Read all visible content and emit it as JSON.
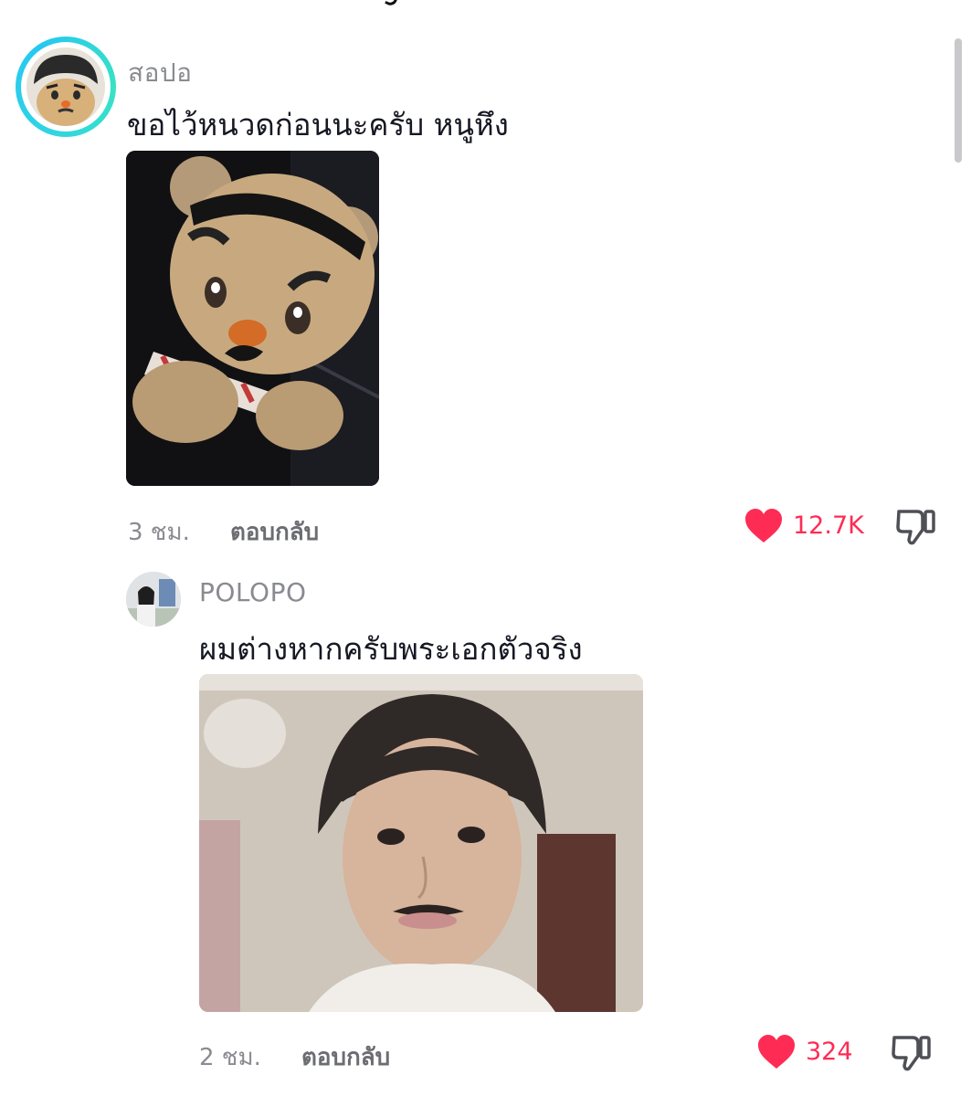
{
  "comments": [
    {
      "username": "สอปอ",
      "text": "ขอไว้หนวดก่อนนะครับ หนูหึง",
      "time": "3 ชม.",
      "reply_label": "ตอบกลับ",
      "likes": "12.7K",
      "liked": true
    },
    {
      "username": "POLOPO",
      "text": "ผมต่างหากครับพระเอกตัวจริง",
      "time": "2 ชม.",
      "reply_label": "ตอบกลับ",
      "likes": "324",
      "liked": true
    }
  ],
  "icons": {
    "like": "heart-icon",
    "dislike": "thumbs-down-icon"
  },
  "colors": {
    "like_red": "#fe2c55",
    "muted_text": "#8a8b91",
    "avatar_ring": "#2fd3e6"
  }
}
